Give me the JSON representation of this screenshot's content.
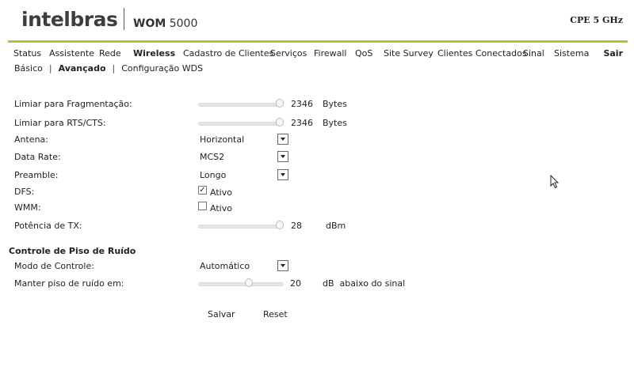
{
  "header": {
    "logo": "intelbras",
    "model_bold": "WOM",
    "model_num": " 5000",
    "band": "CPE 5 GHz"
  },
  "menu": {
    "items": [
      "Status",
      "Assistente",
      "Rede",
      "Wireless",
      "Cadastro de Clientes",
      "Serviços",
      "Firewall",
      "QoS",
      "Site Survey",
      "Clientes Conectados",
      "Sinal",
      "Sistema"
    ],
    "active": "Wireless",
    "logout": "Sair"
  },
  "submenu": {
    "items": [
      "Básico",
      "Avançado",
      "Configuração WDS"
    ],
    "active": "Avançado"
  },
  "form": {
    "fragmentation": {
      "label": "Limiar para Fragmentação:",
      "value": "2346",
      "unit": "Bytes",
      "level": 1.0
    },
    "rts": {
      "label": "Limiar para RTS/CTS:",
      "value": "2346",
      "unit": "Bytes",
      "level": 1.0
    },
    "antenna": {
      "label": "Antena:",
      "value": "Horizontal"
    },
    "data_rate": {
      "label": "Data Rate:",
      "value": "MCS2"
    },
    "preamble": {
      "label": "Preamble:",
      "value": "Longo"
    },
    "dfs": {
      "label": "DFS:",
      "option": "Ativo",
      "checked": true
    },
    "wmm": {
      "label": "WMM:",
      "option": "Ativo",
      "checked": false
    },
    "tx_power": {
      "label": "Potência de TX:",
      "value": "28",
      "unit": "dBm",
      "level": 1.0
    }
  },
  "noise": {
    "title": "Controle de Piso de Ruído",
    "mode": {
      "label": "Modo de Controle:",
      "value": "Automático"
    },
    "floor": {
      "label": "Manter piso de ruído em:",
      "value": "20",
      "unit": "dB  abaixo do sinal",
      "level": 0.6
    }
  },
  "actions": {
    "save": "Salvar",
    "reset": "Reset"
  },
  "colors": {
    "accent": "#9fcb3a"
  }
}
